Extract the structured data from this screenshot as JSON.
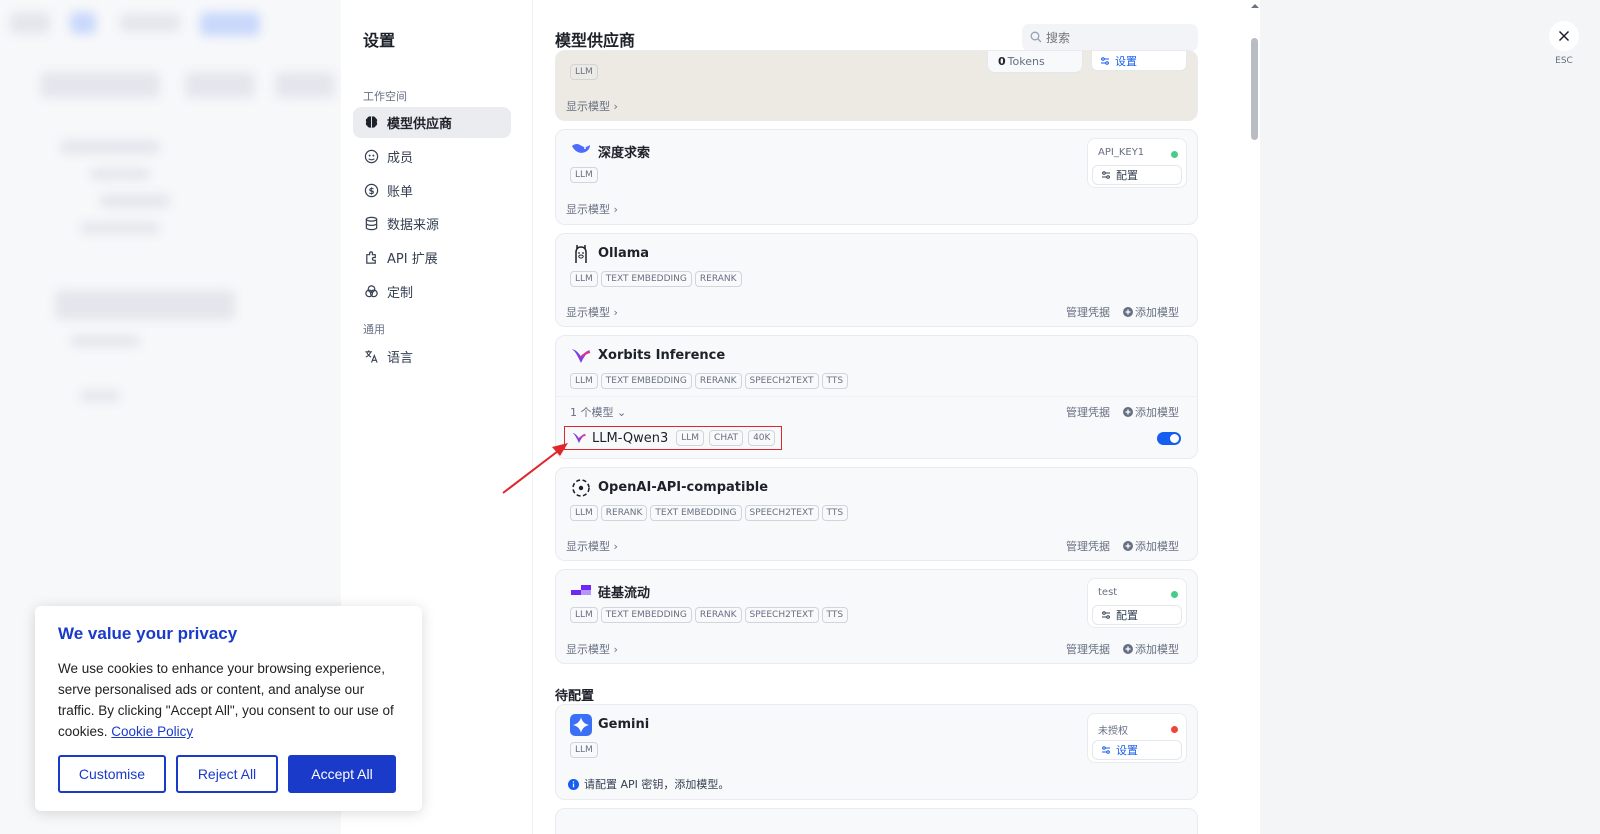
{
  "settings": {
    "title": "设置",
    "workspace_label": "工作空间",
    "general_label": "通用",
    "nav": [
      {
        "label": "模型供应商",
        "icon": "brain-icon",
        "active": true
      },
      {
        "label": "成员",
        "icon": "members-icon"
      },
      {
        "label": "账单",
        "icon": "billing-icon"
      },
      {
        "label": "数据来源",
        "icon": "database-icon"
      },
      {
        "label": "API 扩展",
        "icon": "puzzle-icon"
      },
      {
        "label": "定制",
        "icon": "customize-icon"
      }
    ],
    "general_nav": [
      {
        "label": "语言",
        "icon": "translate-icon"
      }
    ]
  },
  "main": {
    "title": "模型供应商",
    "search_placeholder": "搜索",
    "top_card": {
      "tag": "LLM",
      "show_models": "显示模型",
      "tokens_value": "0",
      "tokens_unit": "Tokens",
      "settings_btn": "设置"
    },
    "providers": [
      {
        "name": "深度求索",
        "tags": [
          "LLM"
        ],
        "show_models": "显示模型",
        "key_label": "API_KEY1",
        "key_btn": "配置",
        "status_color": "#47cd89"
      },
      {
        "name": "Ollama",
        "tags": [
          "LLM",
          "TEXT EMBEDDING",
          "RERANK"
        ],
        "show_models": "显示模型",
        "manage": "管理凭据",
        "add": "添加模型"
      },
      {
        "name": "Xorbits Inference",
        "tags": [
          "LLM",
          "TEXT EMBEDDING",
          "RERANK",
          "SPEECH2TEXT",
          "TTS"
        ],
        "model_count": "1 个模型",
        "manage": "管理凭据",
        "add": "添加模型",
        "model": {
          "name": "LLM-Qwen3",
          "tags": [
            "LLM",
            "CHAT",
            "40K"
          ],
          "enabled": true
        }
      },
      {
        "name": "OpenAI-API-compatible",
        "tags": [
          "LLM",
          "RERANK",
          "TEXT EMBEDDING",
          "SPEECH2TEXT",
          "TTS"
        ],
        "show_models": "显示模型",
        "manage": "管理凭据",
        "add": "添加模型"
      },
      {
        "name": "硅基流动",
        "tags": [
          "LLM",
          "TEXT EMBEDDING",
          "RERANK",
          "SPEECH2TEXT",
          "TTS"
        ],
        "show_models": "显示模型",
        "manage": "管理凭据",
        "add": "添加模型",
        "key_label": "test",
        "key_btn": "配置",
        "status_color": "#47cd89"
      }
    ],
    "pending_label": "待配置",
    "pending": {
      "name": "Gemini",
      "tags": [
        "LLM"
      ],
      "key_label": "未授权",
      "key_btn": "设置",
      "status_color": "#f04438",
      "notice": "请配置 API 密钥，添加模型。"
    }
  },
  "close": {
    "esc_label": "ESC"
  },
  "cookie": {
    "title": "We value your privacy",
    "body": "We use cookies to enhance your browsing experience, serve personalised ads or content, and analyse our traffic. By clicking \"Accept All\", you consent to our use of cookies.",
    "policy_link": "Cookie Policy",
    "customise": "Customise",
    "reject": "Reject All",
    "accept": "Accept All"
  },
  "colors": {
    "accent": "#155eef",
    "cookie_brand": "#1a3ac9",
    "highlight": "#e0262d"
  }
}
